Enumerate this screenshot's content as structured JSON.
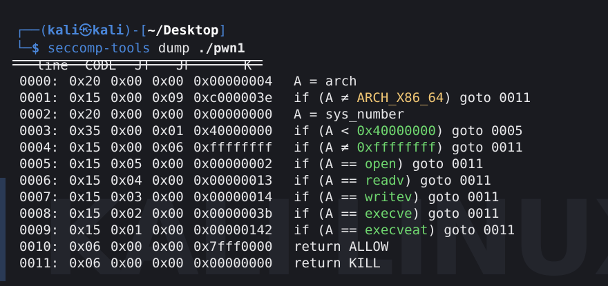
{
  "prompt": {
    "corner_top": "┌──(",
    "user": "kali",
    "skull": "㉿",
    "host": "kali",
    "dash": ")-[",
    "path": "~/Desktop",
    "close": "]",
    "corner_bottom": "└─",
    "dollar": "$",
    "command": "seccomp-tools",
    "args": "dump",
    "target": "./pwn1"
  },
  "header": {
    "line": "line",
    "code": "CODE",
    "jt": "JT",
    "jf": "JF",
    "k": "K"
  },
  "rows": [
    {
      "line": "0000:",
      "code": "0x20",
      "jt": "0x00",
      "jf": "0x00",
      "k": "0x00000004",
      "pre": "A = arch",
      "hl": "",
      "post": ""
    },
    {
      "line": "0001:",
      "code": "0x15",
      "jt": "0x00",
      "jf": "0x09",
      "k": "0xc000003e",
      "pre": "if (A ≠ ",
      "hl": "ARCH_X86_64",
      "post": ") goto 0011",
      "hlcolor": "yellow"
    },
    {
      "line": "0002:",
      "code": "0x20",
      "jt": "0x00",
      "jf": "0x00",
      "k": "0x00000000",
      "pre": "A = sys_number",
      "hl": "",
      "post": ""
    },
    {
      "line": "0003:",
      "code": "0x35",
      "jt": "0x00",
      "jf": "0x01",
      "k": "0x40000000",
      "pre": "if (A < ",
      "hl": "0x40000000",
      "post": ") goto 0005",
      "hlcolor": "green"
    },
    {
      "line": "0004:",
      "code": "0x15",
      "jt": "0x00",
      "jf": "0x06",
      "k": "0xffffffff",
      "pre": "if (A ≠ ",
      "hl": "0xffffffff",
      "post": ") goto 0011",
      "hlcolor": "green"
    },
    {
      "line": "0005:",
      "code": "0x15",
      "jt": "0x05",
      "jf": "0x00",
      "k": "0x00000002",
      "pre": "if (A == ",
      "hl": "open",
      "post": ") goto 0011",
      "hlcolor": "green"
    },
    {
      "line": "0006:",
      "code": "0x15",
      "jt": "0x04",
      "jf": "0x00",
      "k": "0x00000013",
      "pre": "if (A == ",
      "hl": "readv",
      "post": ") goto 0011",
      "hlcolor": "green"
    },
    {
      "line": "0007:",
      "code": "0x15",
      "jt": "0x03",
      "jf": "0x00",
      "k": "0x00000014",
      "pre": "if (A == ",
      "hl": "writev",
      "post": ") goto 0011",
      "hlcolor": "green"
    },
    {
      "line": "0008:",
      "code": "0x15",
      "jt": "0x02",
      "jf": "0x00",
      "k": "0x0000003b",
      "pre": "if (A == ",
      "hl": "execve",
      "post": ") goto 0011",
      "hlcolor": "green"
    },
    {
      "line": "0009:",
      "code": "0x15",
      "jt": "0x01",
      "jf": "0x00",
      "k": "0x00000142",
      "pre": "if (A == ",
      "hl": "execveat",
      "post": ") goto 0011",
      "hlcolor": "green"
    },
    {
      "line": "0010:",
      "code": "0x06",
      "jt": "0x00",
      "jf": "0x00",
      "k": "0x7fff0000",
      "pre": "return ALLOW",
      "hl": "",
      "post": ""
    },
    {
      "line": "0011:",
      "code": "0x06",
      "jt": "0x00",
      "jf": "0x00",
      "k": "0x00000000",
      "pre": "return KILL",
      "hl": "",
      "post": ""
    }
  ],
  "colors": {
    "background": "#1a1b20",
    "prompt_blue": "#4a86d9",
    "text": "#e8e8ea",
    "green": "#6fd66f",
    "yellow": "#f0c674"
  }
}
